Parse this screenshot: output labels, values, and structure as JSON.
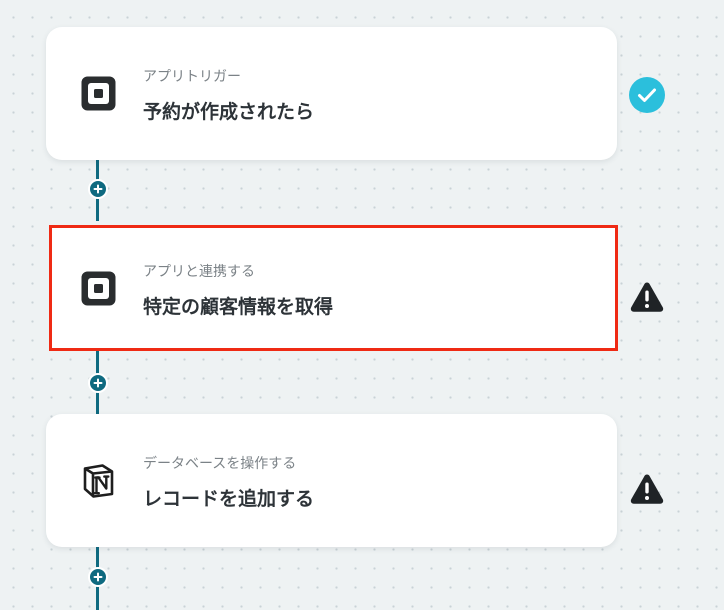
{
  "theme": {
    "connector_color": "#0f6a80",
    "highlight_color": "#ef2a14",
    "success_color": "#2bbfdc",
    "warning_color": "#1f2326"
  },
  "steps": [
    {
      "kind": "アプリトリガー",
      "title": "予約が作成されたら",
      "app_icon": "square-logo-icon",
      "status_icon": "check-circle-icon"
    },
    {
      "kind": "アプリと連携する",
      "title": "特定の顧客情報を取得",
      "app_icon": "square-logo-icon",
      "status_icon": "warning-icon"
    },
    {
      "kind": "データベースを操作する",
      "title": "レコードを追加する",
      "app_icon": "notion-logo-icon",
      "status_icon": "warning-icon"
    }
  ],
  "add_step_icon": "plus-icon"
}
